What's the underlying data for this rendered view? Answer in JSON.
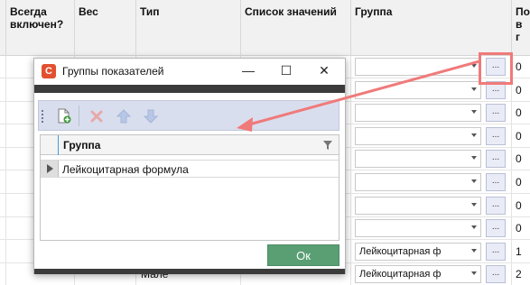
{
  "grid": {
    "headers": {
      "always_on": "Всегда включен?",
      "weight": "Вес",
      "type": "Тип",
      "values_list": "Список значений",
      "group": "Группа",
      "last_col": "По в г"
    },
    "rows": [
      {
        "group": "",
        "num": "0"
      },
      {
        "group": "",
        "num": "0"
      },
      {
        "group": "",
        "num": "0"
      },
      {
        "group": "",
        "num": "0"
      },
      {
        "group": "",
        "num": "0"
      },
      {
        "group": "",
        "num": "0"
      },
      {
        "group": "",
        "num": "0"
      },
      {
        "group": "",
        "num": "0"
      },
      {
        "group": "Лейкоцитарная ф",
        "num": "1"
      },
      {
        "group": "Лейкоцитарная ф",
        "num": "2"
      }
    ],
    "dots_label": "...",
    "partial_type_text": "Мале"
  },
  "dialog": {
    "title": "Группы показателей",
    "app_icon_letter": "C",
    "minimize": "—",
    "maximize": "☐",
    "close": "✕",
    "column_header": "Группа",
    "rows": [
      "Лейкоцитарная формула"
    ],
    "ok_label": "Ок"
  },
  "colors": {
    "annotation": "#f07a7a",
    "ok_button": "#5a9e74",
    "toolbar": "#d9deee"
  }
}
